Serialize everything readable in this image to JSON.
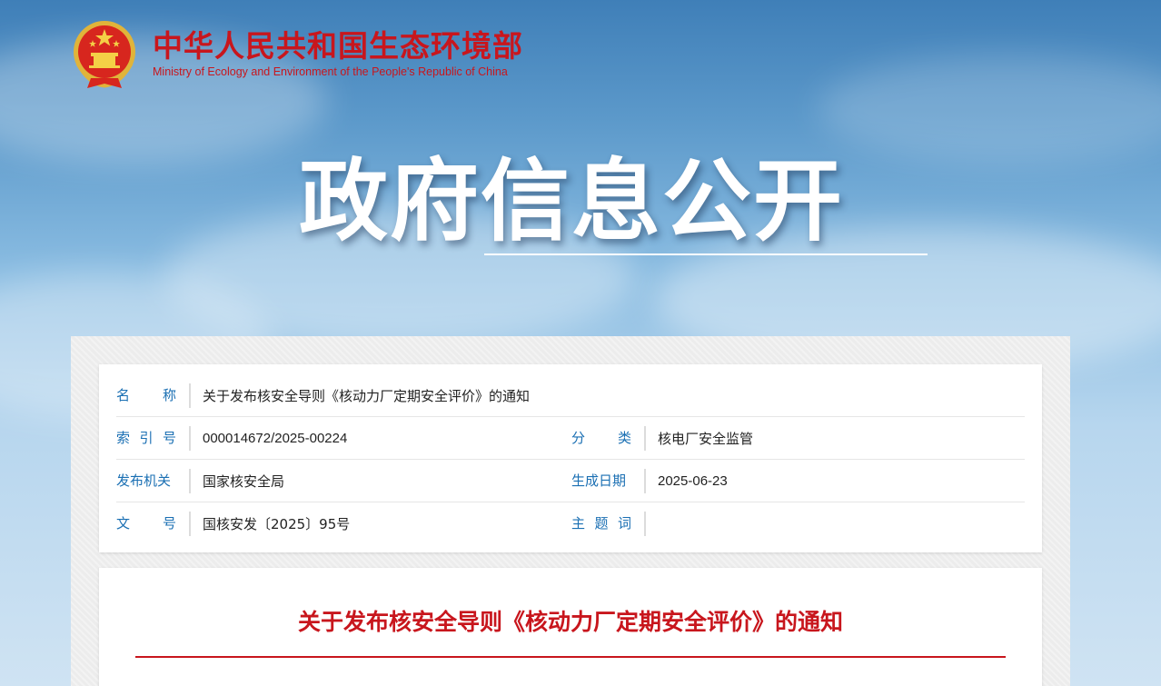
{
  "brand": {
    "name_cn": "中华人民共和国生态环境部",
    "name_en": "Ministry of Ecology and Environment of the People's Republic of China",
    "emblem_icon": "national-emblem-icon",
    "color": "#c8161d"
  },
  "hero": {
    "title": "政府信息公开"
  },
  "info": {
    "row1": {
      "label": "名称",
      "value": "关于发布核安全导则《核动力厂定期安全评价》的通知"
    },
    "row2": {
      "left_label": "索引号",
      "left_value": "000014672/2025-00224",
      "right_label": "分类",
      "right_value": "核电厂安全监管"
    },
    "row3": {
      "left_label": "发布机关",
      "left_value": "国家核安全局",
      "right_label": "生成日期",
      "right_value": "2025-06-23"
    },
    "row4": {
      "left_label": "文号",
      "left_value": "国核安发〔2025〕95号",
      "right_label": "主题词",
      "right_value": ""
    },
    "label_color": "#1a6fb3"
  },
  "document": {
    "title": "关于发布核安全导则《核动力厂定期安全评价》的通知",
    "title_color": "#c8161d"
  }
}
